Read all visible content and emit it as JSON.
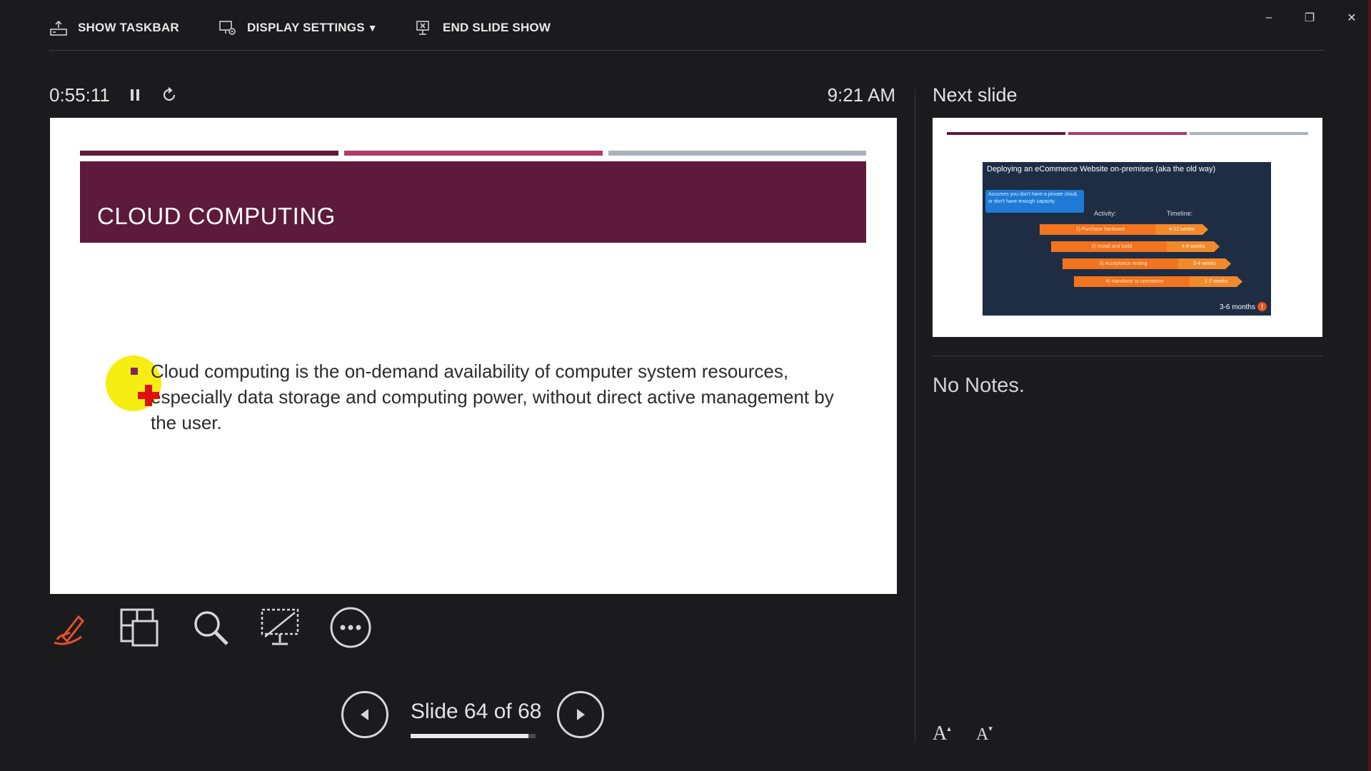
{
  "toolbar": {
    "show_taskbar": "SHOW TASKBAR",
    "display_settings": "DISPLAY SETTINGS",
    "display_settings_arrow": "▼",
    "end_slide_show": "END SLIDE SHOW"
  },
  "window_controls": {
    "minimize": "–",
    "restore": "❐",
    "close": "✕"
  },
  "presenter": {
    "timer": "0:55:11",
    "clock": "9:21 AM",
    "slide_counter": "Slide 64 of 68",
    "progress_fraction": 0.94
  },
  "current_slide": {
    "title": "CLOUD COMPUTING",
    "bullet": "Cloud computing is the on-demand availability of computer system resources, especially data storage and computing power, without direct active management by the user.",
    "bar_colors": [
      "#5e1a3c",
      "#b03a6a",
      "#a9b3bd"
    ],
    "band_color": "#5e1a3c"
  },
  "next_slide": {
    "label": "Next slide",
    "title": "Deploying an eCommerce Website on-premises (aka the old way)",
    "callout": "Assumes you don't have a private cloud, or don't have enough capacity",
    "activity_label": "Activity:",
    "timeline_label": "Timeline:",
    "activities": [
      {
        "activity": "1) Purchase hardware",
        "timeline": "4-12 weeks"
      },
      {
        "activity": "2) Install and build",
        "timeline": "4-8 weeks"
      },
      {
        "activity": "3) Acceptance testing",
        "timeline": "2-4 weeks"
      },
      {
        "activity": "4) Handover to operations",
        "timeline": "1-2 weeks"
      }
    ],
    "total": "3-6 months",
    "alert": "!"
  },
  "notes": {
    "text": "No Notes."
  },
  "font_controls": {
    "increase": "A",
    "decrease": "A"
  },
  "accent_color": "#e2502a"
}
